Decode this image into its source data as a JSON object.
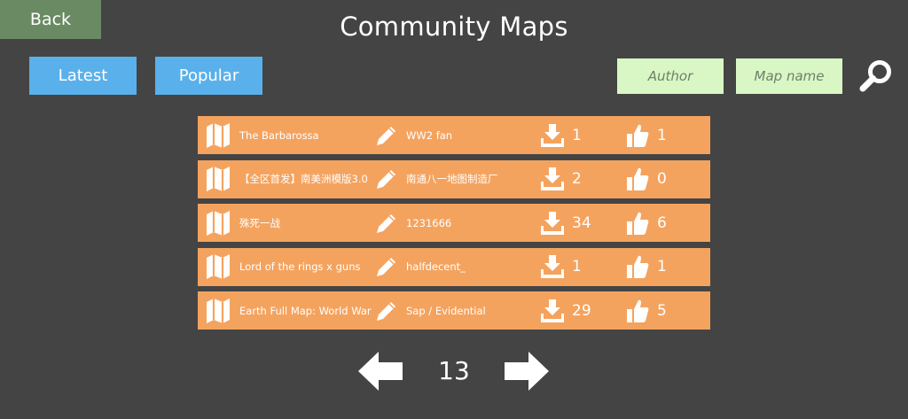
{
  "header": {
    "back_label": "Back",
    "title": "Community Maps"
  },
  "tabs": [
    {
      "label": "Latest"
    },
    {
      "label": "Popular"
    }
  ],
  "search": {
    "author_placeholder": "Author",
    "map_name_placeholder": "Map name",
    "search_icon": "search-icon"
  },
  "maps": [
    {
      "name": "The Barbarossa",
      "author": "WW2 fan",
      "downloads": "1",
      "likes": "1"
    },
    {
      "name": "【全区首发】南美洲模版3.0",
      "author": "南通八一地图制造厂",
      "downloads": "2",
      "likes": "0"
    },
    {
      "name": "殊死一战",
      "author": "1231666",
      "downloads": "34",
      "likes": "6"
    },
    {
      "name": "Lord of the rings x guns",
      "author": "halfdecent_",
      "downloads": "1",
      "likes": "1"
    },
    {
      "name": "Earth Full Map: World War",
      "author": "Sap / Evidential",
      "downloads": "29",
      "likes": "5"
    }
  ],
  "pager": {
    "page": "13"
  },
  "colors": {
    "background": "#444444",
    "back_button": "#6a8a64",
    "tab_button": "#5ab0ea",
    "search_field": "#d9f7c4",
    "row": "#f4a35f"
  }
}
